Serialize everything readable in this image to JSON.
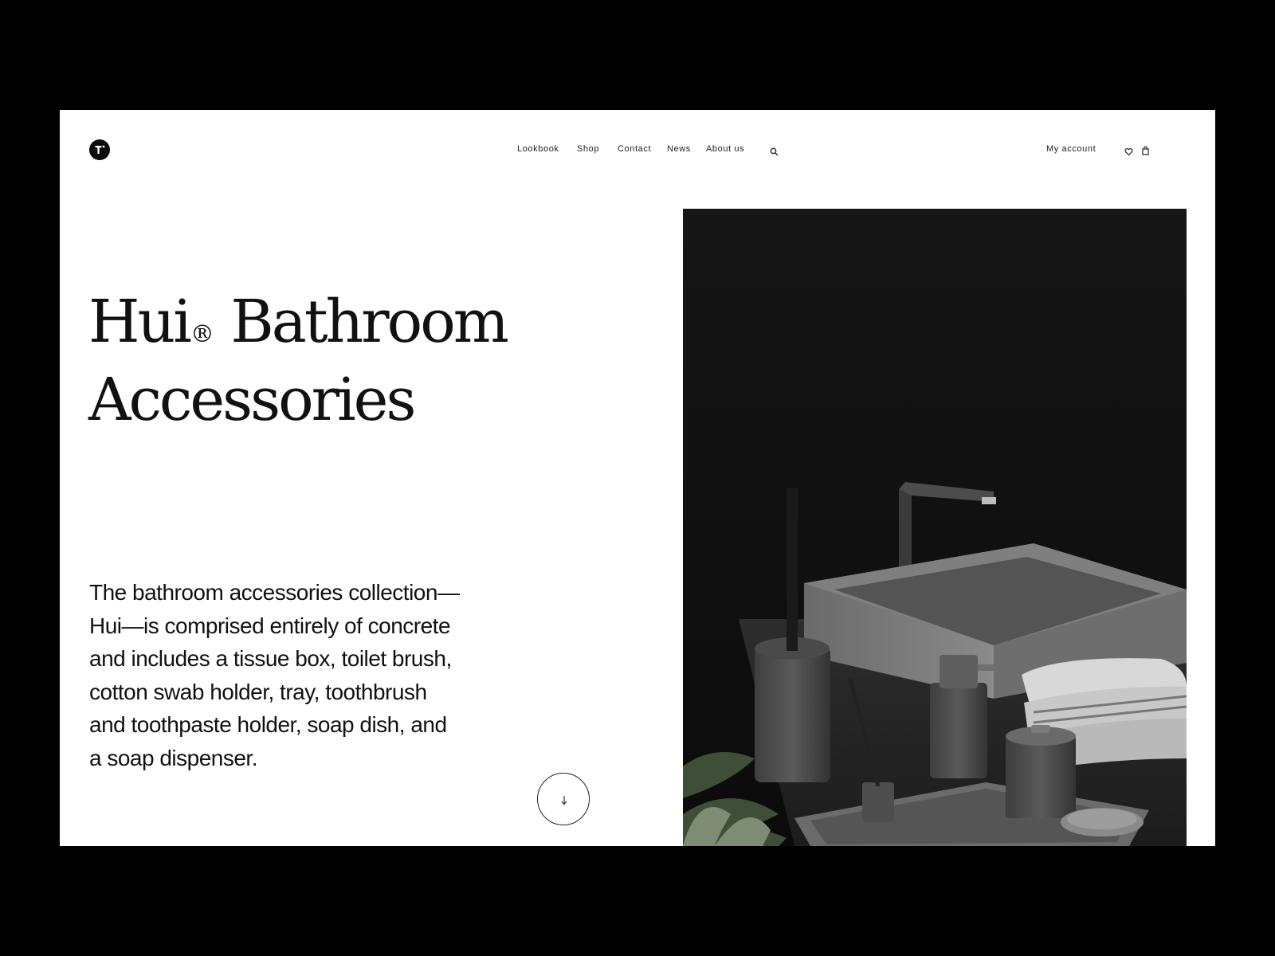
{
  "brand": {
    "logo_icon": "logo-mark-icon"
  },
  "nav": {
    "items": [
      {
        "label": "Lookbook"
      },
      {
        "label": "Shop"
      },
      {
        "label": "Contact"
      },
      {
        "label": "News"
      },
      {
        "label": "About us"
      }
    ],
    "search_icon": "search-icon"
  },
  "account": {
    "label": "My account",
    "wishlist_icon": "heart-icon",
    "cart_icon": "bag-icon"
  },
  "hero": {
    "title_line1": "Hui",
    "title_mark": "®",
    "title_line1_rest": "Bathroom",
    "title_line2": "Accessories",
    "description": "The bathroom accessories collection—Hui—is comprised entirely of concrete and includes a tissue box, toilet brush, cotton swab holder, tray, toothbrush and toothpaste holder, soap dish, and a soap dispenser.",
    "scroll_icon": "arrow-down-icon",
    "image_alt": "concrete bathroom accessories with sink"
  },
  "colors": {
    "background": "#000000",
    "page": "#ffffff",
    "text": "#111111",
    "image_bg": "#0d0d0d"
  }
}
